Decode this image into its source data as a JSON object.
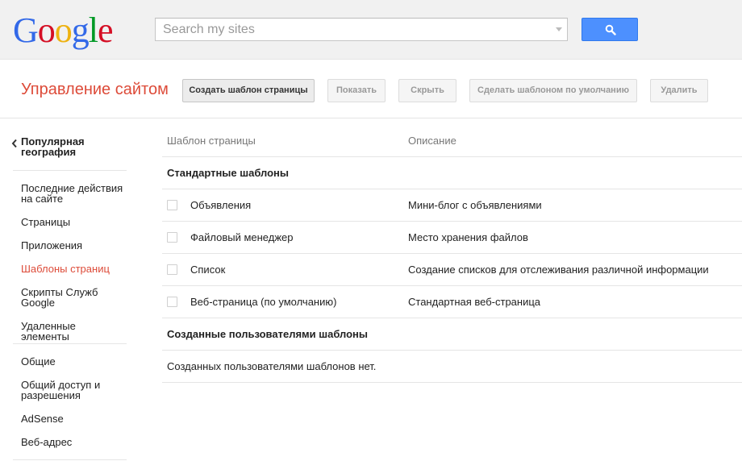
{
  "header": {
    "logo_letters": [
      "G",
      "o",
      "o",
      "g",
      "l",
      "e"
    ],
    "search_placeholder": "Search my sites",
    "search_value": ""
  },
  "page": {
    "title": "Управление сайтом"
  },
  "toolbar": {
    "create_template": "Создать шаблон страницы",
    "show": "Показать",
    "hide": "Скрыть",
    "make_default": "Сделать шаблоном по умолчанию",
    "delete": "Удалить"
  },
  "sidebar": {
    "back_label": "Популярная география",
    "group1": [
      {
        "label": "Последние действия на сайте",
        "selected": false
      },
      {
        "label": "Страницы",
        "selected": false
      },
      {
        "label": "Приложения",
        "selected": false
      },
      {
        "label": "Шаблоны страниц",
        "selected": true
      },
      {
        "label": "Скрипты Служб Google",
        "selected": false
      },
      {
        "label": "Удаленные элементы",
        "selected": false
      }
    ],
    "group2": [
      {
        "label": "Общие"
      },
      {
        "label": "Общий доступ и разрешения"
      },
      {
        "label": "AdSense"
      },
      {
        "label": "Веб-адрес"
      }
    ]
  },
  "table": {
    "col_template": "Шаблон страницы",
    "col_description": "Описание",
    "standard_section": "Стандартные шаблоны",
    "rows": [
      {
        "name": "Объявления",
        "description": "Мини-блог с объявлениями"
      },
      {
        "name": "Файловый менеджер",
        "description": "Место хранения файлов"
      },
      {
        "name": "Список",
        "description": "Создание списков для отслеживания различной информации"
      },
      {
        "name": "Веб-страница (по умолчанию)",
        "description": "Стандартная веб-страница"
      }
    ],
    "user_section": "Созданные пользователями шаблоны",
    "user_empty": "Созданных пользователями шаблонов нет."
  },
  "colors": {
    "accent_red": "#dd4b39",
    "search_blue": "#4d90fe",
    "logo": [
      "#3369e8",
      "#d50f25",
      "#eeb211",
      "#3369e8",
      "#009925",
      "#d50f25"
    ]
  }
}
